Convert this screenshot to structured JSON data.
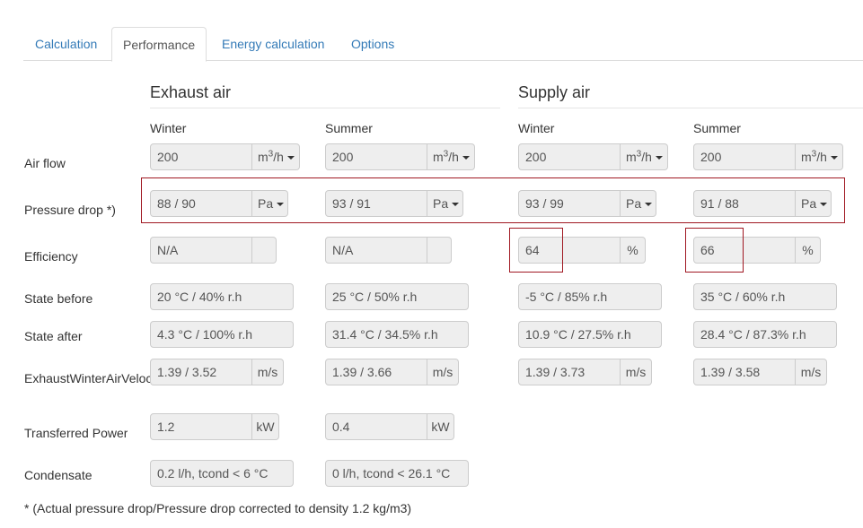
{
  "tabs": [
    {
      "label": "Calculation",
      "active": false
    },
    {
      "label": "Performance",
      "active": true
    },
    {
      "label": "Energy calculation",
      "active": false
    },
    {
      "label": "Options",
      "active": false
    }
  ],
  "groups": {
    "exhaust": {
      "title": "Exhaust air",
      "winter": "Winter",
      "summer": "Summer"
    },
    "supply": {
      "title": "Supply air",
      "winter": "Winter",
      "summer": "Summer"
    }
  },
  "rows": {
    "air_flow": {
      "label": "Air flow",
      "unit_base": "m",
      "unit_exp": "3",
      "unit_tail": "/h",
      "exhaust_winter": "200",
      "exhaust_summer": "200",
      "supply_winter": "200",
      "supply_summer": "200"
    },
    "pressure_drop": {
      "label": "Pressure drop *)",
      "unit": "Pa",
      "exhaust_winter": "88 / 90",
      "exhaust_summer": "93 / 91",
      "supply_winter": "93 / 99",
      "supply_summer": "91 / 88"
    },
    "efficiency": {
      "label": "Efficiency",
      "unit": "%",
      "exhaust_winter": "N/A",
      "exhaust_summer": "N/A",
      "supply_winter": "64",
      "supply_summer": "66"
    },
    "state_before": {
      "label": "State before",
      "exhaust_winter": "20 °C / 40% r.h",
      "exhaust_summer": "25 °C / 50% r.h",
      "supply_winter": "-5 °C / 85% r.h",
      "supply_summer": "35 °C / 60% r.h"
    },
    "state_after": {
      "label": "State after",
      "exhaust_winter": "4.3 °C / 100% r.h",
      "exhaust_summer": "31.4 °C / 34.5% r.h",
      "supply_winter": "10.9 °C / 27.5% r.h",
      "supply_summer": "28.4 °C / 87.3% r.h"
    },
    "velocity": {
      "label": "ExhaustWinterAirVelocity",
      "unit": "m/s",
      "exhaust_winter": "1.39 / 3.52",
      "exhaust_summer": "1.39 / 3.66",
      "supply_winter": "1.39 / 3.73",
      "supply_summer": "1.39 / 3.58"
    },
    "transferred_power": {
      "label": "Transferred Power",
      "unit": "kW",
      "exhaust_winter": "1.2",
      "exhaust_summer": "0.4"
    },
    "condensate": {
      "label": "Condensate",
      "exhaust_winter": "0.2 l/h, tcond < 6 °C",
      "exhaust_summer": "0 l/h, tcond < 26.1 °C"
    }
  },
  "footnote": "* (Actual pressure drop/Pressure drop corrected to density 1.2 kg/m3)",
  "highlight_color": "#a01822"
}
